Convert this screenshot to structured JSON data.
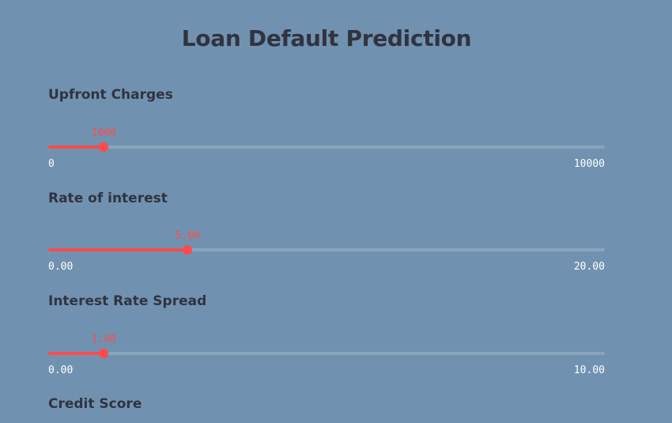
{
  "page": {
    "title": "Loan Default Prediction"
  },
  "colors": {
    "background": "#7092b0",
    "accent": "#ff4b4b",
    "text": "#31333f",
    "tick_text": "#ffffff"
  },
  "sliders": [
    {
      "label": "Upfront Charges",
      "value": "1000",
      "min": "0",
      "max": "10000",
      "fraction": 0.1
    },
    {
      "label": "Rate of interest",
      "value": "5.00",
      "min": "0.00",
      "max": "20.00",
      "fraction": 0.25
    },
    {
      "label": "Interest Rate Spread",
      "value": "1.00",
      "min": "0.00",
      "max": "10.00",
      "fraction": 0.1
    }
  ],
  "next_field": {
    "label": "Credit Score"
  }
}
